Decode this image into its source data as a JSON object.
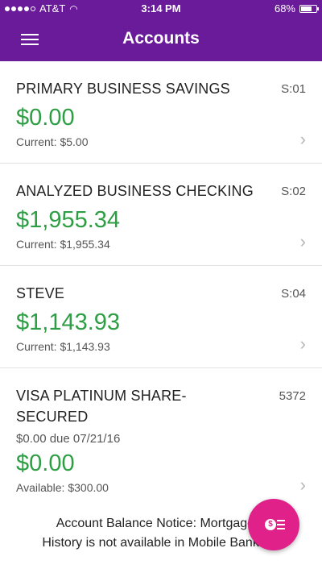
{
  "status_bar": {
    "carrier": "AT&T",
    "time": "3:14 PM",
    "battery_percent": "68%",
    "battery_level": 0.68
  },
  "header": {
    "title": "Accounts",
    "menu_icon": "hamburger-menu-icon"
  },
  "accounts": [
    {
      "name": "PRIMARY BUSINESS SAVINGS",
      "code": "S:01",
      "amount": "$0.00",
      "detail": "Current: $5.00"
    },
    {
      "name": "ANALYZED BUSINESS CHECKING",
      "code": "S:02",
      "amount": "$1,955.34",
      "detail": "Current: $1,955.34"
    },
    {
      "name": "STEVE",
      "code": "S:04",
      "amount": "$1,143.93",
      "detail": "Current: $1,143.93"
    },
    {
      "name_line1": "VISA PLATINUM SHARE-",
      "name_line2": "SECURED",
      "code": "5372",
      "due": "$0.00 due 07/21/16",
      "amount": "$0.00",
      "detail": "Available: $300.00"
    }
  ],
  "notice": {
    "line1": "Account Balance Notice: Mortgage A",
    "line2": "History is not available in Mobile Banking."
  },
  "fab": {
    "icon": "dollar-transfer-icon",
    "symbol": "$"
  },
  "colors": {
    "header": "#6a1b9a",
    "amount": "#2e9e44",
    "fab": "#e0218a"
  }
}
